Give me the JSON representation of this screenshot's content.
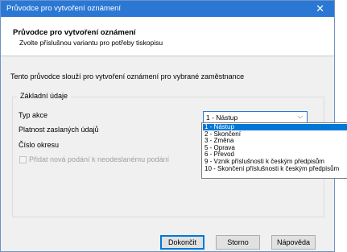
{
  "window": {
    "title": "Průvodce pro vytvoření oznámení",
    "close_glyph": "✕"
  },
  "header": {
    "title": "Průvodce pro vytvoření oznámení",
    "subtitle": "Zvolte příslušnou variantu pro potřeby tiskopisu"
  },
  "description": "Tento průvodce slouží pro vytvoření oznámení pro vybrané zaměstnance",
  "group": {
    "legend": "Základní údaje",
    "fields": {
      "typ_akce": "Typ akce",
      "platnost": "Platnost zaslaných údajů",
      "cislo_okresu": "Číslo okresu",
      "pridat": "Přidat nová podání k neodeslanému podání"
    }
  },
  "combo": {
    "selected": "1 - Nástup",
    "arrow_icon": "chevron-down-icon"
  },
  "dropdown": {
    "options": [
      "1 - Nástup",
      "2 - Skončení",
      "3 - Změna",
      "5 - Oprava",
      "6 - Převod",
      "9 - Vznik příslušnosti k českým předpisům",
      "10 - Skončení příslušnosti k českým předpisům"
    ],
    "selected_index": 0
  },
  "buttons": {
    "finish": "Dokončit",
    "cancel": "Storno",
    "help": "Nápověda"
  },
  "colors": {
    "titlebar": "#2b78d4",
    "selection": "#0078d7",
    "dialog_bg": "#f0f0f0"
  }
}
